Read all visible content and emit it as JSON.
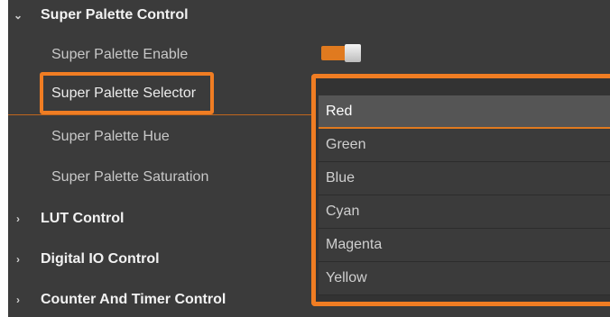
{
  "sections": {
    "super_palette_control": {
      "label": "Super Palette Control",
      "chevron": "expanded",
      "properties": [
        {
          "label": "Super Palette Enable"
        },
        {
          "label": "Super Palette Selector"
        },
        {
          "label": "Super Palette Hue"
        },
        {
          "label": "Super Palette Saturation"
        }
      ],
      "enable_toggle": {
        "state": "on",
        "color": "#e07a1f"
      }
    },
    "lut_control": {
      "label": "LUT Control",
      "chevron": "collapsed"
    },
    "digital_io_control": {
      "label": "Digital IO Control",
      "chevron": "collapsed"
    },
    "counter_and_timer_control": {
      "label": "Counter And Timer Control",
      "chevron": "collapsed"
    }
  },
  "chevrons": {
    "expanded": "⌄",
    "collapsed": "›"
  },
  "dropdown": {
    "selected": "Red",
    "options": [
      "Red",
      "Green",
      "Blue",
      "Cyan",
      "Magenta",
      "Yellow"
    ]
  },
  "colors": {
    "panel_bg": "#3b3b3b",
    "highlight": "#f07d23",
    "accent": "#e07a1f"
  }
}
